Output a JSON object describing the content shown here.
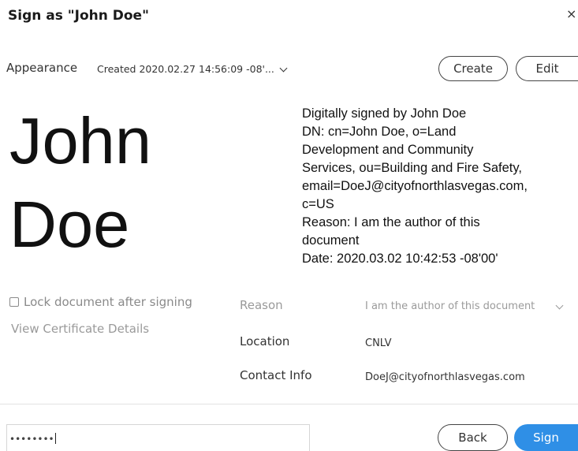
{
  "dialog": {
    "title": "Sign as \"John Doe\"",
    "close_glyph": "×"
  },
  "appearance": {
    "label": "Appearance",
    "selected": "Created 2020.02.27 14:56:09 -08'...",
    "create_label": "Create",
    "edit_label": "Edit"
  },
  "signature": {
    "first_name": "John",
    "last_name": "Doe",
    "details": "Digitally signed by John Doe\nDN: cn=John Doe, o=Land\nDevelopment and Community\nServices, ou=Building and Fire Safety,\nemail=DoeJ@cityofnorthlasvegas.com,\nc=US\nReason: I am the author of this\ndocument\nDate: 2020.03.02 10:42:53 -08'00'"
  },
  "options": {
    "lock_label": "Lock document after signing",
    "lock_checked": false,
    "view_cert_label": "View Certificate Details"
  },
  "fields": {
    "reason_label": "Reason",
    "reason_value": "I am the author of this document",
    "location_label": "Location",
    "location_value": "CNLV",
    "contact_label": "Contact Info",
    "contact_value": "DoeJ@cityofnorthlasvegas.com"
  },
  "footer": {
    "password_mask": "••••••••",
    "back_label": "Back",
    "sign_label": "Sign"
  },
  "colors": {
    "sign_button": "#2f8fe6",
    "muted_text": "#9a9a9a"
  }
}
